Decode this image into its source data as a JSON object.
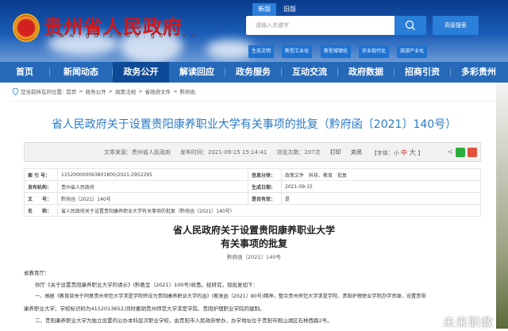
{
  "header": {
    "site_title": "贵州省人民政府",
    "site_url": "www.guizhou.gov.cn",
    "version_new": "新版",
    "version_old": "旧版",
    "search_placeholder": "请输入关键字",
    "advanced_search": "高级搜索",
    "tags": [
      "生态文明",
      "新型工业化",
      "新型城镇化",
      "农业现代化",
      "旅游产业化"
    ]
  },
  "nav": {
    "items": [
      "首页",
      "新闻动态",
      "政务公开",
      "解读回应",
      "政务服务",
      "互动交流",
      "政府数据",
      "招商引资",
      "多彩贵州"
    ],
    "active": "政务公开"
  },
  "breadcrumb": {
    "label": "您当前所在的位置:",
    "items": [
      "首页",
      "政务公开",
      "政策法规",
      "省政府文件",
      "黔府函"
    ]
  },
  "article": {
    "title": "省人民政府关于设置贵阳康养职业大学有关事项的批复（黔府函〔2021〕140号）",
    "source": "文章来源：贵州省人民政府",
    "publish_time": "发布时间：2021-09-15 15:14:41",
    "views": "浏览次数：207次",
    "print": "打印",
    "close": "关闭",
    "font_label": "【字体：",
    "font_small": "小",
    "font_medium": "中",
    "font_large": "大",
    "font_end": "】"
  },
  "meta": {
    "index_k": "索 引 号：",
    "index_v": "115200000093801800/2021-2952295",
    "cat_k": "信息分类：",
    "cat_v": "政策文件　科技、教育　批复",
    "org_k": "发布机构：",
    "org_v": "贵州省人民政府",
    "date_k": "生成日期：",
    "date_v": "2021-09-15",
    "no_k": "文　　号：",
    "no_v": "黔府函〔2021〕140号",
    "valid_k": "是否有效：",
    "valid_v": "是",
    "name_k": "名　　称：",
    "name_v": "省人民政府关于设置贵阳康养职业大学有关事项的批复（黔府函〔2021〕140号）"
  },
  "body": {
    "heading1": "省人民政府关于设置贵阳康养职业大学",
    "heading2": "有关事项的批复",
    "doc_no": "黔府函〔2021〕140号",
    "salutation": "省教育厅：",
    "p1": "你厅《关于设置贵阳康养职业大学的请示》(黔教呈〔2021〕100号)收悉。经研究，现批复如下：",
    "p2a": "一、根据《教育部关于同意贵州师范大学求是学院转设为贵阳康养职业大学的函》(教发函〔2021〕80号)精神，整合贵州师范大学求是学院、贵阳护理职业学院办学资源，设置贵阳",
    "p2b": "康养职业大学，学校标识码为4152013652;同时撤销贵州师范大学求是学院、贵阳护理职业学院的建制。",
    "p3": "二、贵阳康养职业大学为独立设置的公办本科层次职业学校，由贵阳市人民政府举办，办学地址位于贵阳市观山湖区石林西路2号。"
  },
  "watermark": "未来职教"
}
